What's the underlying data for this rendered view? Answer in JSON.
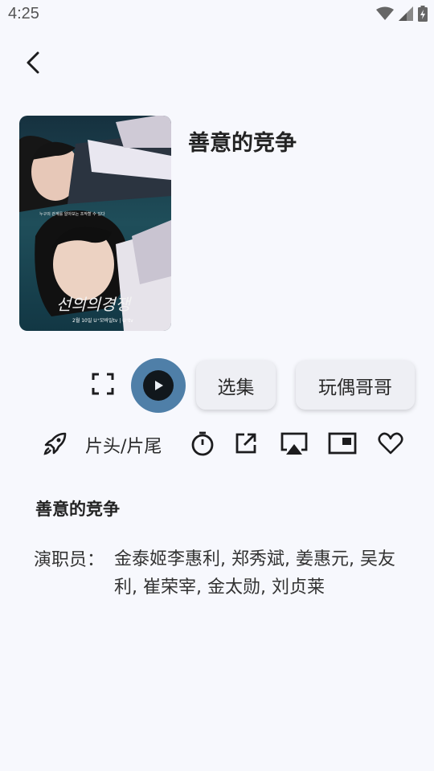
{
  "status": {
    "time": "4:25"
  },
  "detail": {
    "title": "善意的竞争",
    "poster_alt": "선의의경쟁",
    "poster_text": {
      "logo": "선의의경쟁",
      "tagline": "누구의 관계를 알아보는 조작할 수 있다",
      "release": "2월 10일 U⁺모바일tv | U⁺tv"
    },
    "episodes_label": "选集",
    "source_label": "玩偶哥哥",
    "skip_label": "片头/片尾",
    "info_title": "善意的竞争",
    "cast_label": "演职员：",
    "cast_value": "金泰姬李惠利, 郑秀斌, 姜惠元, 吴友利, 崔荣宰, 金太勋, 刘贞莱"
  },
  "colors": {
    "background": "#f7f8fd",
    "play_ring": "#4f7fa8",
    "pill_bg": "#eeeff4"
  },
  "icons": [
    "arrow-back-icon",
    "fullscreen-icon",
    "play-icon",
    "rocket-icon",
    "timer-icon",
    "open-external-icon",
    "airplay-icon",
    "picture-in-picture-icon",
    "heart-outline-icon",
    "wifi-icon",
    "cell-signal-icon",
    "battery-charging-icon"
  ]
}
